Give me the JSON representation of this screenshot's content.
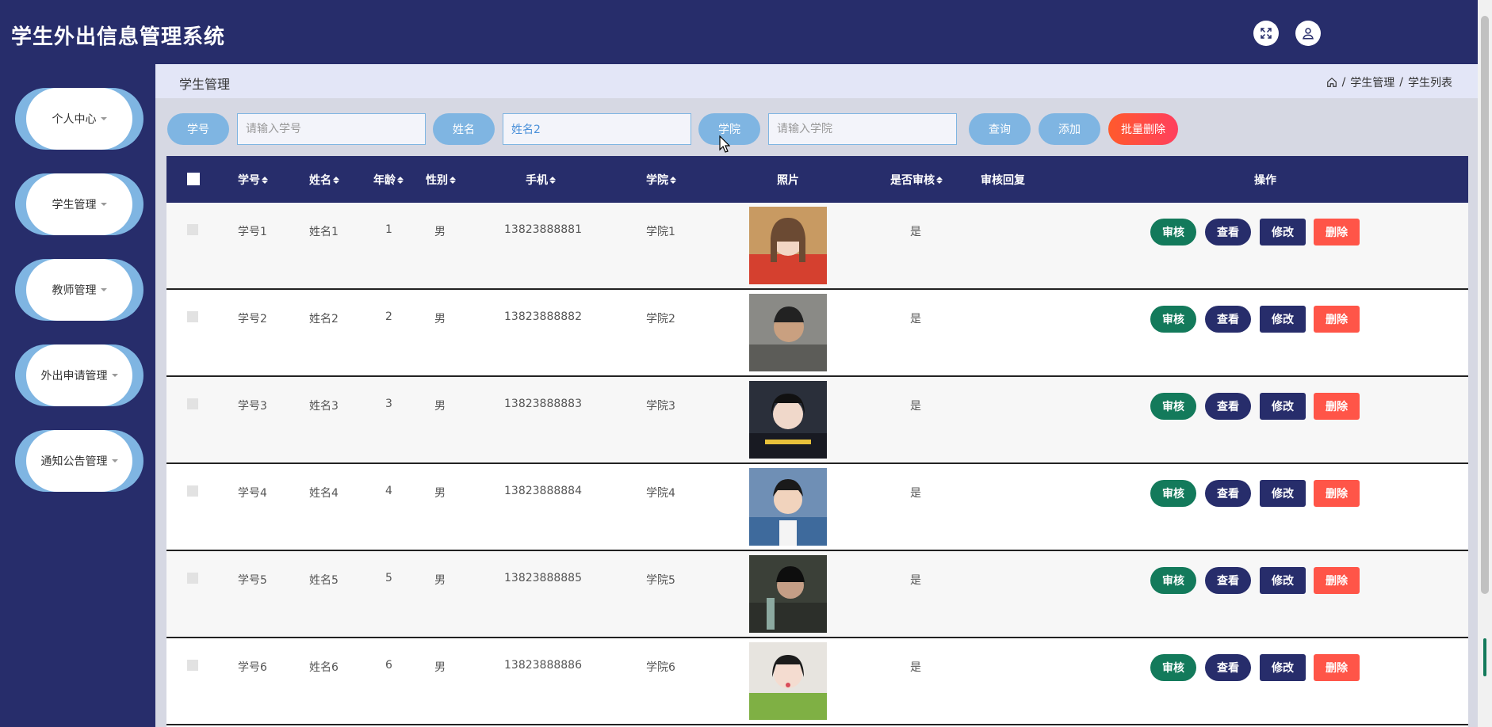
{
  "header": {
    "title": "学生外出信息管理系统",
    "fullscreen_icon": "expand-icon",
    "user_icon": "user-icon"
  },
  "sidebar": {
    "items": [
      {
        "label": "个人中心"
      },
      {
        "label": "学生管理"
      },
      {
        "label": "教师管理"
      },
      {
        "label": "外出申请管理"
      },
      {
        "label": "通知公告管理"
      }
    ]
  },
  "breadcrumb": {
    "title": "学生管理",
    "home_icon": "home-icon",
    "sep": "/",
    "path1": "学生管理",
    "path2": "学生列表"
  },
  "search": {
    "xuehao_label": "学号",
    "xuehao_placeholder": "请输入学号",
    "xuehao_value": "",
    "name_label": "姓名",
    "name_value": "姓名2",
    "college_label": "学院",
    "college_placeholder": "请输入学院",
    "college_value": "",
    "query_button": "查询",
    "add_button": "添加",
    "batch_delete_button": "批量删除"
  },
  "table": {
    "columns": [
      "学号",
      "姓名",
      "年龄",
      "性别",
      "手机",
      "学院",
      "照片",
      "是否审核",
      "审核回复",
      "操作"
    ],
    "actions": {
      "audit": "审核",
      "view": "查看",
      "edit": "修改",
      "delete": "删除"
    },
    "rows": [
      {
        "xuehao": "学号1",
        "name": "姓名1",
        "age": "1",
        "gender": "男",
        "phone": "13823888881",
        "college": "学院1",
        "audited": "是",
        "reply": ""
      },
      {
        "xuehao": "学号2",
        "name": "姓名2",
        "age": "2",
        "gender": "男",
        "phone": "13823888882",
        "college": "学院2",
        "audited": "是",
        "reply": ""
      },
      {
        "xuehao": "学号3",
        "name": "姓名3",
        "age": "3",
        "gender": "男",
        "phone": "13823888883",
        "college": "学院3",
        "audited": "是",
        "reply": ""
      },
      {
        "xuehao": "学号4",
        "name": "姓名4",
        "age": "4",
        "gender": "男",
        "phone": "13823888884",
        "college": "学院4",
        "audited": "是",
        "reply": ""
      },
      {
        "xuehao": "学号5",
        "name": "姓名5",
        "age": "5",
        "gender": "男",
        "phone": "13823888885",
        "college": "学院5",
        "audited": "是",
        "reply": ""
      },
      {
        "xuehao": "学号6",
        "name": "姓名6",
        "age": "6",
        "gender": "男",
        "phone": "13823888886",
        "college": "学院6",
        "audited": "是",
        "reply": ""
      }
    ]
  },
  "colors": {
    "primary": "#272d6b",
    "accent_blue": "#7fb5e2",
    "audit_green": "#137a5b",
    "delete_red": "#ff5548"
  }
}
